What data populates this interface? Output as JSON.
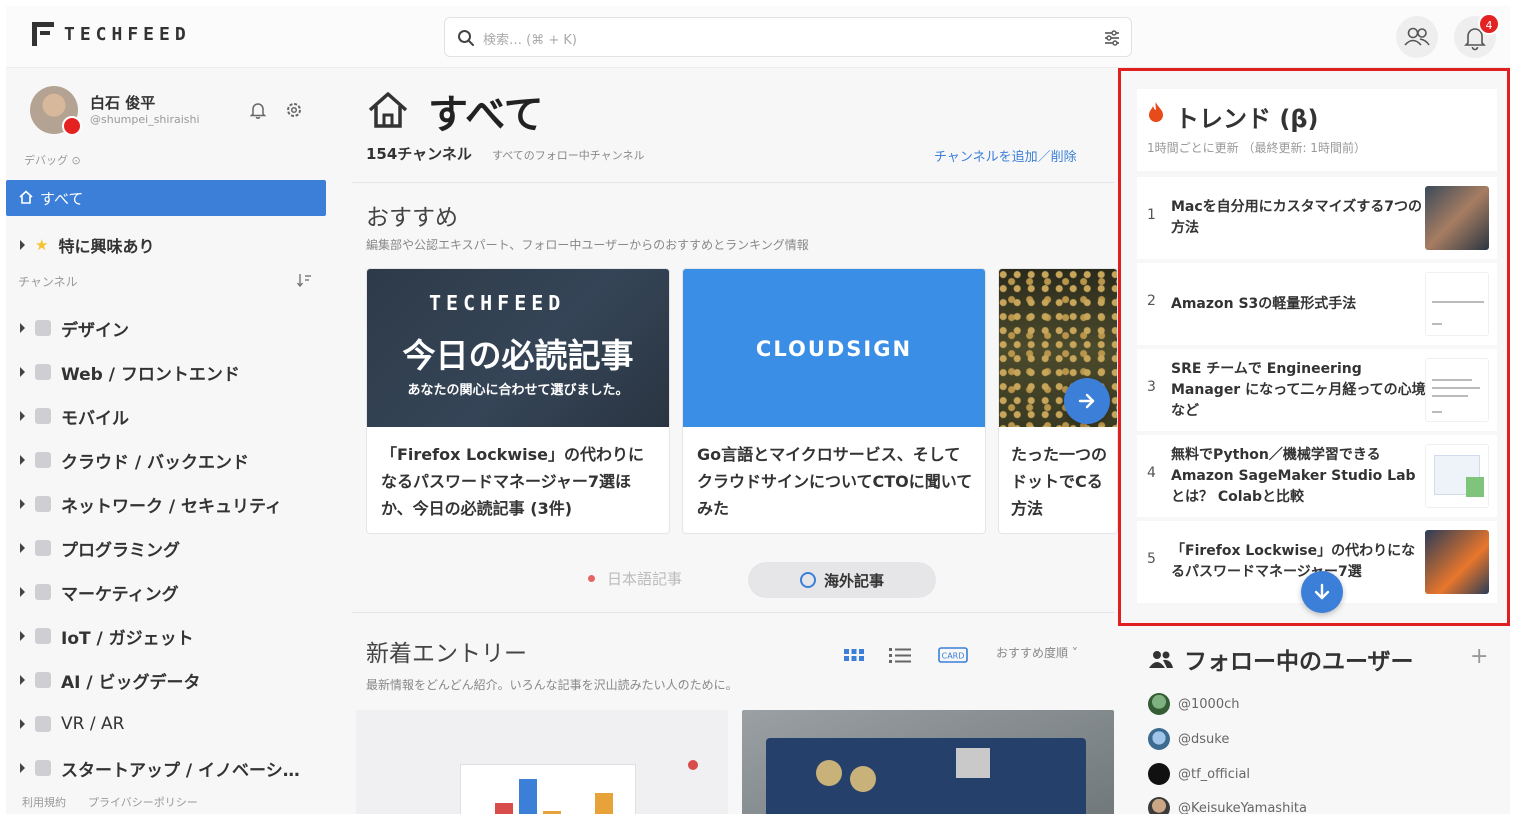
{
  "header": {
    "logo_text": "TECHFEED",
    "search_placeholder": "検索… (⌘ + K)",
    "notification_count": "4"
  },
  "sidebar": {
    "user_name": "白石 俊平",
    "user_handle": "@shumpei_shiraishi",
    "debug_label": "デバッグ ⊙",
    "all_label": "すべて",
    "favorites_label": "特に興味あり",
    "channels_label": "チャンネル",
    "categories": [
      {
        "label": "デザイン",
        "icon": "pen-icon"
      },
      {
        "label": "Web / フロントエンド",
        "icon": "web-icon"
      },
      {
        "label": "モバイル",
        "icon": "mobile-icon"
      },
      {
        "label": "クラウド / バックエンド",
        "icon": "cloud-icon"
      },
      {
        "label": "ネットワーク / セキュリティ",
        "icon": "wifi-icon"
      },
      {
        "label": "プログラミング",
        "icon": "code-icon"
      },
      {
        "label": "マーケティング",
        "icon": "target-icon"
      },
      {
        "label": "IoT / ガジェット",
        "icon": "gadget-icon"
      },
      {
        "label": "AI / ビッグデータ",
        "icon": "ai-icon"
      },
      {
        "label": "VR / AR",
        "icon": "vr-icon"
      },
      {
        "label": "スタートアップ / イノベーシ…",
        "icon": "rocket-icon"
      }
    ],
    "footer_terms": "利用規約",
    "footer_privacy": "プライバシーポリシー"
  },
  "main": {
    "title": "すべて",
    "channel_count": "154チャンネル",
    "channel_count_sub": "すべてのフォロー中チャンネル",
    "add_channel": "チャンネルを追加／削除",
    "recommended_title": "おすすめ",
    "recommended_sub": "編集部や公認エキスパート、フォロー中ユーザーからのおすすめとランキング情報",
    "cards": [
      {
        "thumb_logo": "TECHFEED",
        "thumb_big": "今日の必読記事",
        "thumb_small": "あなたの関心に合わせて選びました。",
        "title": "「Firefox Lockwise」の代わりになるパスワードマネージャー7選ほか、今日の必読記事 (3件)"
      },
      {
        "thumb_logo": "CLOUDSIGN",
        "title": "Go言語とマイクロサービス、そしてクラウドサインについてCTOに聞いてみた"
      },
      {
        "title": "たった一つのドットでCる方法"
      }
    ],
    "lang_jp": "日本語記事",
    "lang_en": "海外記事",
    "new_title": "新着エントリー",
    "new_sub": "最新情報をどんどん紹介。いろんな記事を沢山読みたい人のために。",
    "sort_label": "おすすめ度順 ˅",
    "view_card_label": "CARD"
  },
  "trend": {
    "title": "トレンド (β)",
    "sub": "1時間ごとに更新 （最終更新: 1時間前）",
    "items": [
      {
        "rank": "1",
        "title": "Macを自分用にカスタマイズする7つの方法"
      },
      {
        "rank": "2",
        "title": "Amazon S3の軽量形式手法"
      },
      {
        "rank": "3",
        "title": "SRE チームで Engineering Manager になって二ヶ月経っての心境など"
      },
      {
        "rank": "4",
        "title": "無料でPython／機械学習できる Amazon SageMaker Studio Labとは？ Colabと比較"
      },
      {
        "rank": "5",
        "title": "「Firefox Lockwise」の代わりになるパスワードマネージャー7選"
      }
    ]
  },
  "follow": {
    "title": "フォロー中のユーザー",
    "plus": "+",
    "users": [
      "@1000ch",
      "@dsuke",
      "@tf_official",
      "@KeisukeYamashita"
    ]
  },
  "colors": {
    "accent": "#3b7fd9",
    "highlight": "#e02020",
    "badge": "#e52222"
  }
}
